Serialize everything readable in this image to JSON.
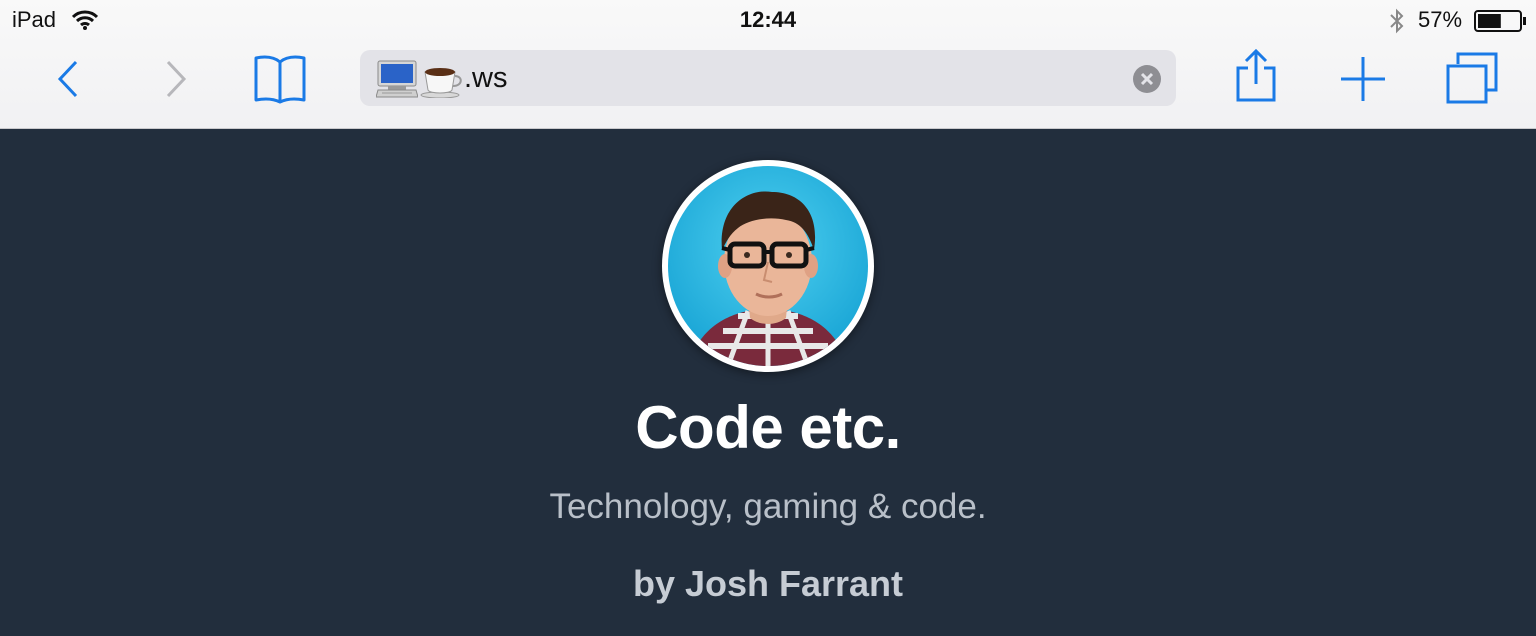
{
  "status_bar": {
    "device": "iPad",
    "time": "12:44",
    "battery_percent": "57%",
    "battery_level": 0.57
  },
  "toolbar": {
    "address_text": ".ws",
    "address_emoji": [
      "computer",
      "coffee"
    ],
    "icons": [
      "back-icon",
      "forward-icon",
      "bookmarks-icon",
      "share-icon",
      "new-tab-icon",
      "tabs-icon"
    ],
    "accent_color": "#1a7ae6"
  },
  "page": {
    "title": "Code etc.",
    "tagline": "Technology, gaming & code.",
    "author": "by Josh Farrant",
    "background_color": "#222e3d"
  }
}
